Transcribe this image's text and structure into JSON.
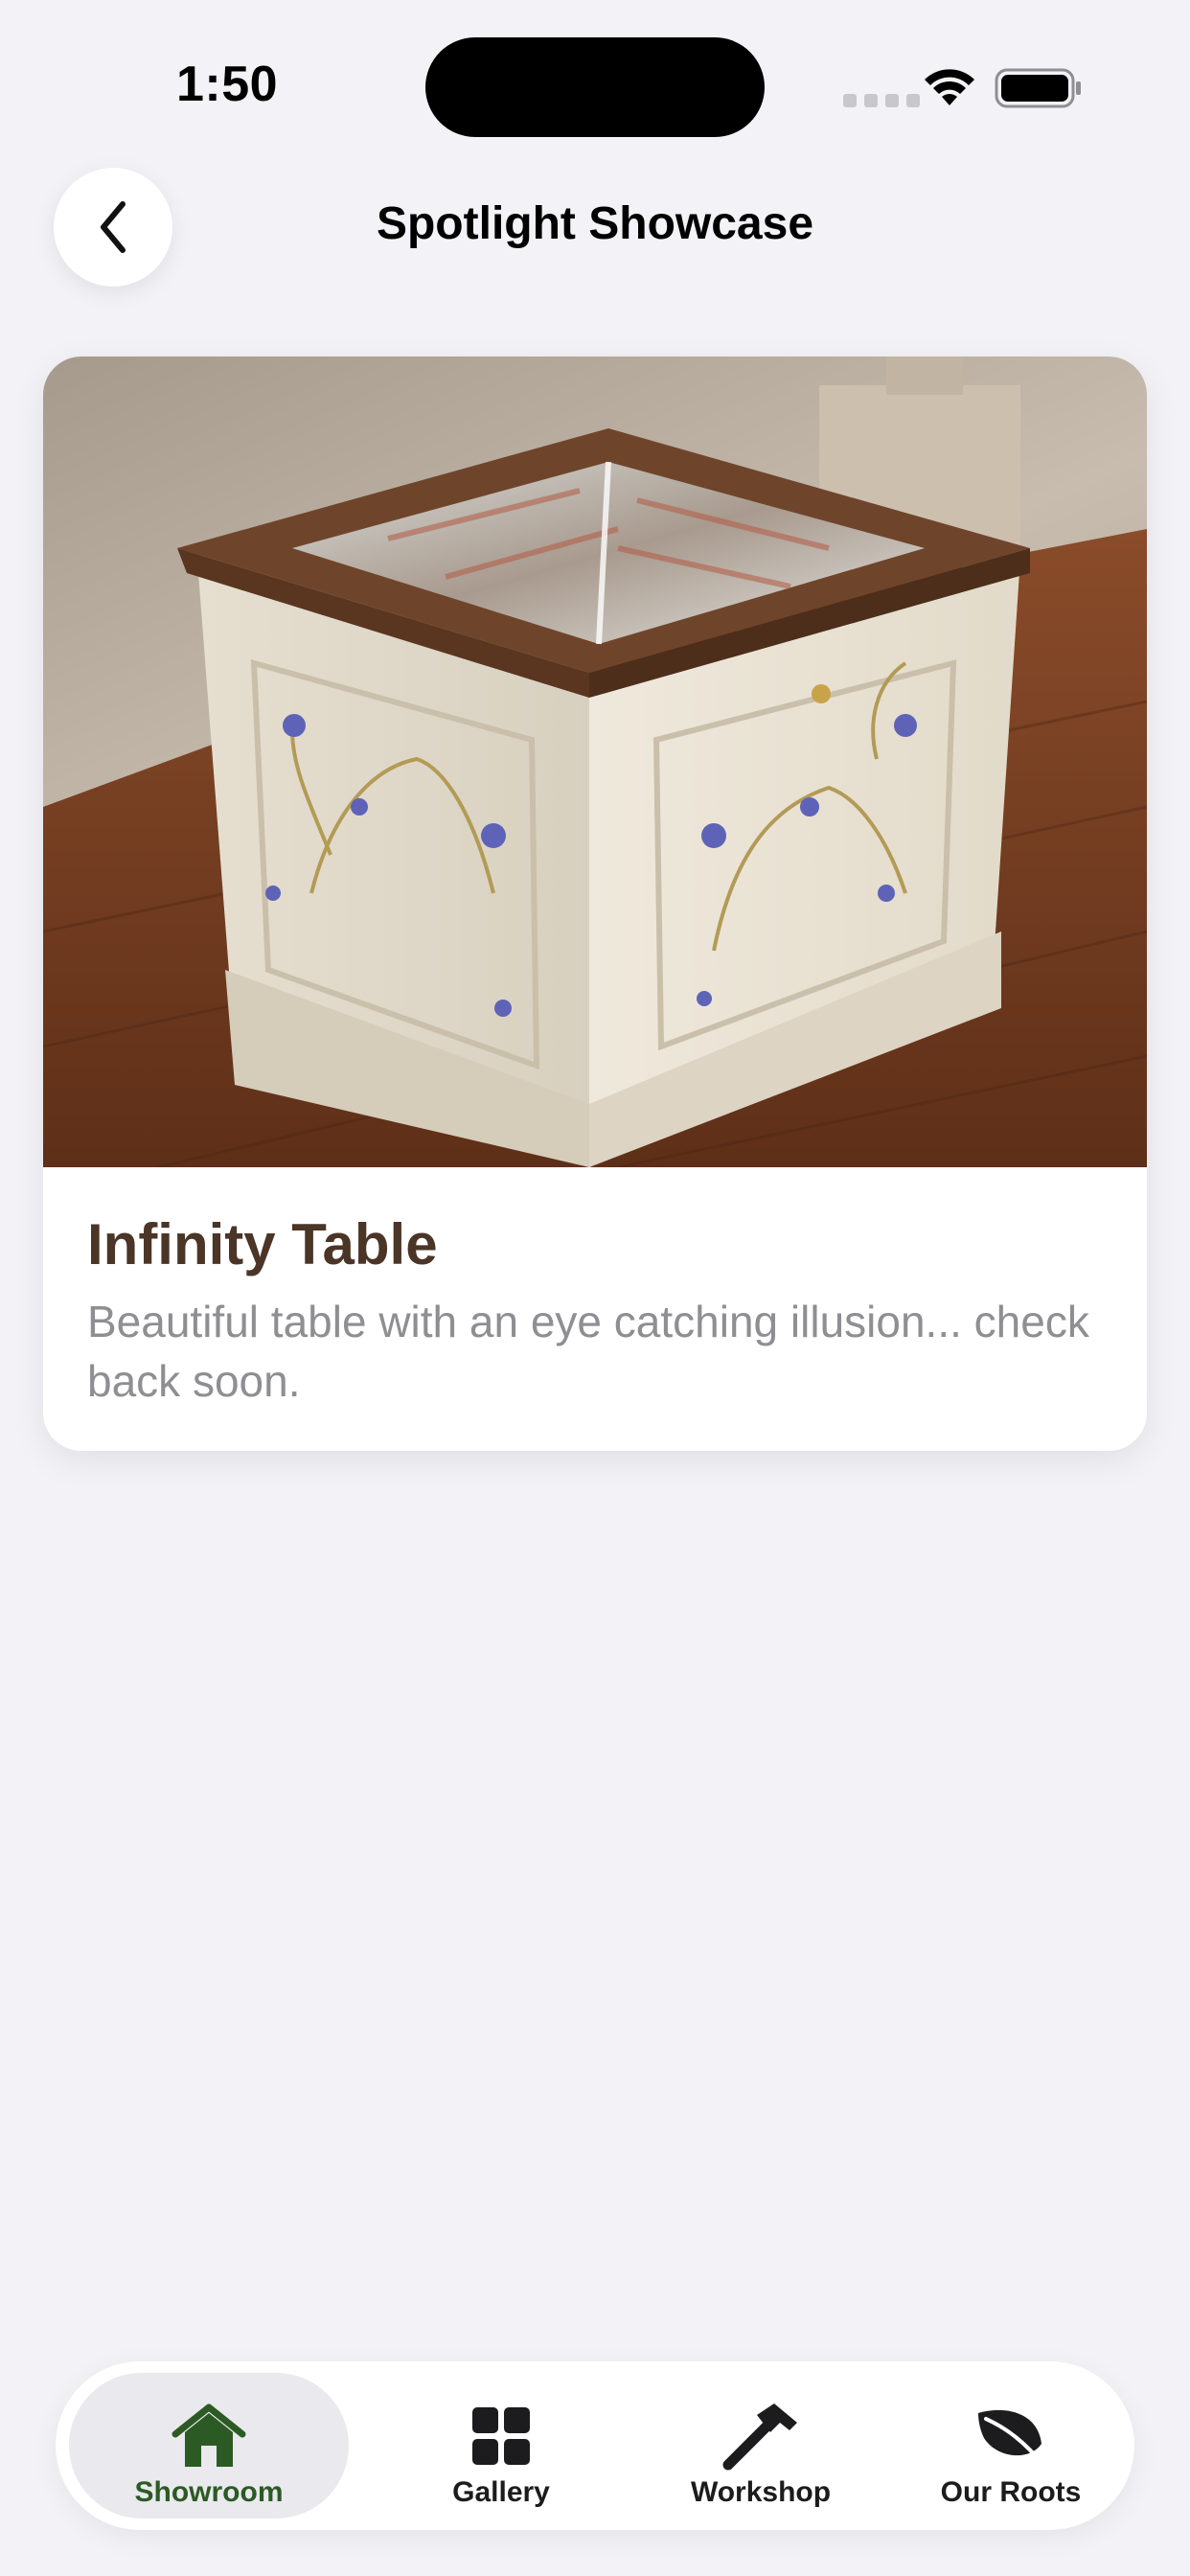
{
  "status_bar": {
    "time": "1:50"
  },
  "header": {
    "title": "Spotlight Showcase"
  },
  "card": {
    "title": "Infinity Table",
    "description": "Beautiful table with an eye catching illusion... check back soon."
  },
  "tab_bar": {
    "items": [
      {
        "label": "Showroom",
        "icon": "house-icon",
        "active": true
      },
      {
        "label": "Gallery",
        "icon": "grid-icon",
        "active": false
      },
      {
        "label": "Workshop",
        "icon": "hammer-icon",
        "active": false
      },
      {
        "label": "Our Roots",
        "icon": "leaf-icon",
        "active": false
      }
    ]
  },
  "colors": {
    "accent": "#2c5a24",
    "title_brown": "#4a3526",
    "background": "#f2f2f7"
  }
}
